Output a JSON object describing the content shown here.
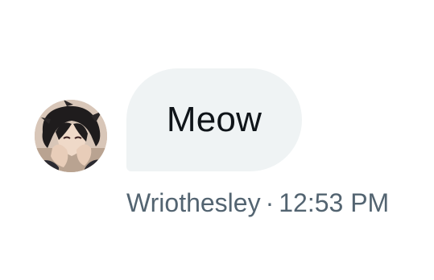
{
  "message": {
    "text": "Meow",
    "sender": "Wriothesley",
    "separator": "·",
    "time": "12:53 PM"
  },
  "colors": {
    "bubble_bg": "#eff3f4",
    "text": "#0f1419",
    "meta_text": "#536471"
  },
  "icons": {
    "avatar": "user-avatar-image"
  }
}
